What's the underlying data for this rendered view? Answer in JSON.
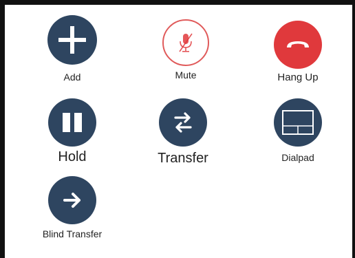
{
  "colors": {
    "navy": "#2e4560",
    "red": "#e0393c",
    "mute_ring": "#e05a5a",
    "white": "#ffffff"
  },
  "buttons": {
    "add": {
      "label": "Add",
      "icon": "plus-icon"
    },
    "mute": {
      "label": "Mute",
      "icon": "microphone-muted-icon"
    },
    "hangup": {
      "label": "Hang Up",
      "icon": "phone-hangup-icon"
    },
    "hold": {
      "label": "Hold",
      "icon": "pause-icon"
    },
    "transfer": {
      "label": "Transfer",
      "icon": "transfer-arrows-icon"
    },
    "dialpad": {
      "label": "Dialpad",
      "icon": "dialpad-icon"
    },
    "blind_transfer": {
      "label": "Blind Transfer",
      "icon": "arrow-right-icon"
    }
  }
}
